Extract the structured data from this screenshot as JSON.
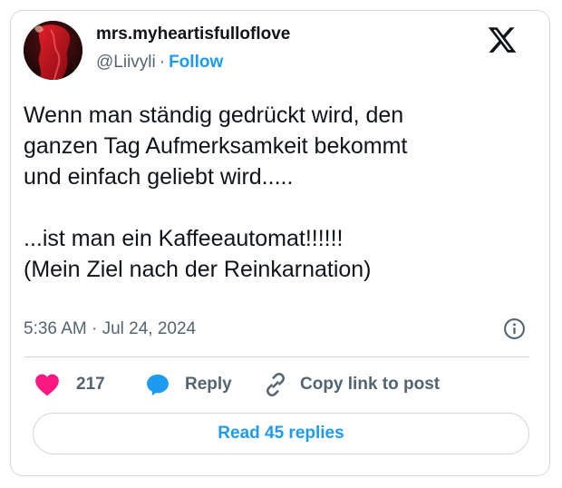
{
  "author": {
    "display_name": "mrs.myheartisfulloflove",
    "handle": "@Liivyli",
    "separator": "·",
    "follow_label": "Follow"
  },
  "tweet": {
    "lines": [
      "Wenn man ständig gedrückt wird, den",
      "ganzen Tag Aufmerksamkeit bekommt",
      "und einfach geliebt wird.....",
      "",
      "...ist man ein Kaffeeautomat!!!!!!",
      "(Mein Ziel nach der Reinkarnation)"
    ],
    "timestamp": "5:36 AM · Jul 24, 2024"
  },
  "actions": {
    "like_count": "217",
    "reply_label": "Reply",
    "copy_link_label": "Copy link to post"
  },
  "read_replies_label": "Read 45 replies",
  "icons": {
    "logo": "x-logo-icon",
    "info": "info-icon",
    "like": "heart-icon",
    "reply": "speech-bubble-icon",
    "copy": "link-icon"
  },
  "colors": {
    "accent": "#1d9bf0",
    "like": "#f91880",
    "muted": "#536471",
    "text": "#0f1419",
    "border": "#cfd9de"
  }
}
